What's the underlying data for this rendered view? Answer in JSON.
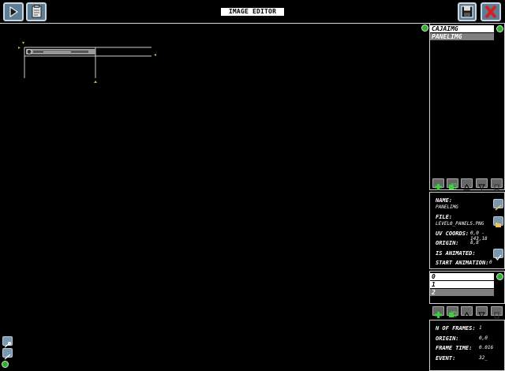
{
  "header": {
    "title": "IMAGE EDITOR"
  },
  "image_list": {
    "items": [
      {
        "label": "CAJAIMG",
        "selected": false
      },
      {
        "label": "PANELIMG",
        "selected": true
      }
    ]
  },
  "image_props": {
    "name_label": "NAME:",
    "name_value": "PANELIMG",
    "file_label": "FILE:",
    "file_value": "LEVEL0_PANELS.PNG",
    "uv_label": "UV COORDS:",
    "uv_value": "0,0 - 143,18",
    "origin_label": "ORIGIN:",
    "origin_value": "8,8",
    "animated_label": "IS ANIMATED:",
    "start_anim_label": "START ANIMATION:",
    "start_anim_value": "0"
  },
  "frame_list": {
    "items": [
      {
        "label": "0",
        "selected": false
      },
      {
        "label": "1",
        "selected": false
      },
      {
        "label": "2",
        "selected": true
      }
    ]
  },
  "frame_props": {
    "nframes_label": "N OF FRAMES:",
    "nframes_value": "1",
    "origin_label": "ORIGIN:",
    "origin_value": "0,0",
    "frame_time_label": "FRAME TIME:",
    "frame_time_value": "0.016",
    "event_label": "EVENT:",
    "event_value": "32_"
  },
  "colors": {
    "accent_green": "#2fae2f",
    "button_blue": "#5c7f97",
    "selected_row": "#7f7f7f",
    "close_red": "#d62020"
  }
}
